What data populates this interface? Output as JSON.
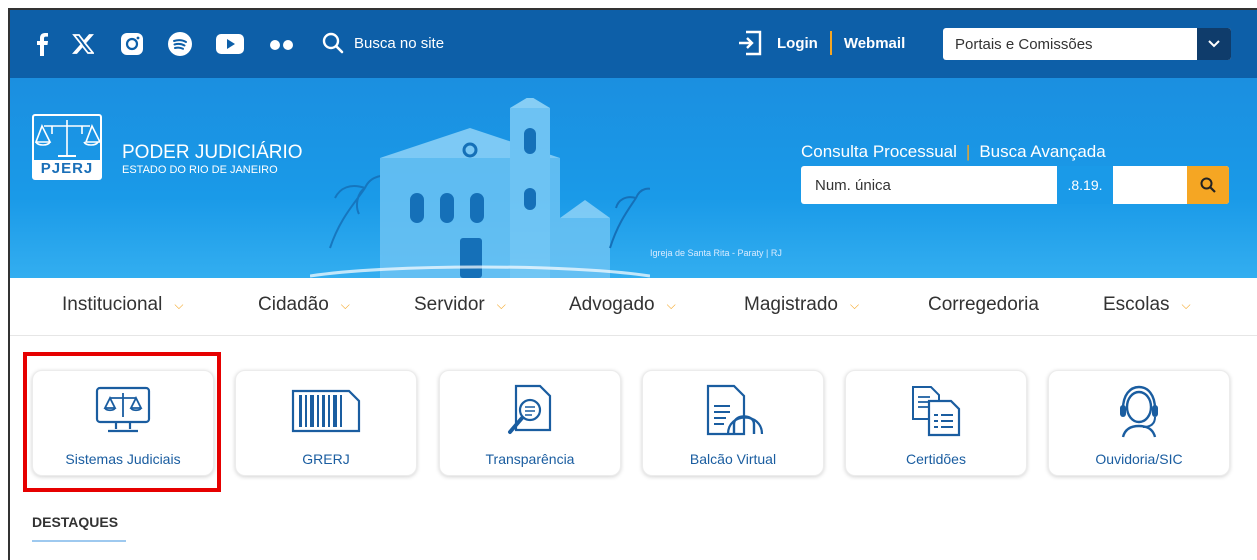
{
  "topbar": {
    "social_icons": [
      "facebook-icon",
      "x-twitter-icon",
      "instagram-icon",
      "spotify-icon",
      "youtube-icon",
      "flickr-icon"
    ],
    "search_label": "Busca no site",
    "login_label": "Login",
    "webmail_label": "Webmail",
    "portals_select": "Portais e Comissões"
  },
  "banner": {
    "brand_abbr": "PJERJ",
    "brand_title": "PODER JUDICIÁRIO",
    "brand_subtitle": "ESTADO DO RIO DE JANEIRO",
    "caption": "Igreja de Santa Rita - Paraty | RJ",
    "consulta_label": "Consulta Processual",
    "busca_avancada_label": "Busca Avançada",
    "numero_placeholder": "Num. única",
    "numero_suffix": ".8.19."
  },
  "nav": {
    "items": [
      {
        "label": "Institucional",
        "has_dropdown": true
      },
      {
        "label": "Cidadão",
        "has_dropdown": true
      },
      {
        "label": "Servidor",
        "has_dropdown": true
      },
      {
        "label": "Advogado",
        "has_dropdown": true
      },
      {
        "label": "Magistrado",
        "has_dropdown": true
      },
      {
        "label": "Corregedoria",
        "has_dropdown": false
      },
      {
        "label": "Escolas",
        "has_dropdown": true
      }
    ]
  },
  "shortcuts": [
    {
      "label": "Sistemas Judiciais",
      "icon": "monitor-scales-icon",
      "highlighted": true
    },
    {
      "label": "GRERJ",
      "icon": "barcode-icon"
    },
    {
      "label": "Transparência",
      "icon": "document-magnifier-icon"
    },
    {
      "label": "Balcão Virtual",
      "icon": "document-arch-icon"
    },
    {
      "label": "Certidões",
      "icon": "documents-icon"
    },
    {
      "label": "Ouvidoria/SIC",
      "icon": "headset-icon"
    }
  ],
  "section": {
    "destaques_label": "DESTAQUES"
  },
  "colors": {
    "topbar": "#0d5fa8",
    "banner": "#1a9ae8",
    "accent": "#f5a623",
    "link": "#1a5da0",
    "highlight": "#e60000"
  }
}
